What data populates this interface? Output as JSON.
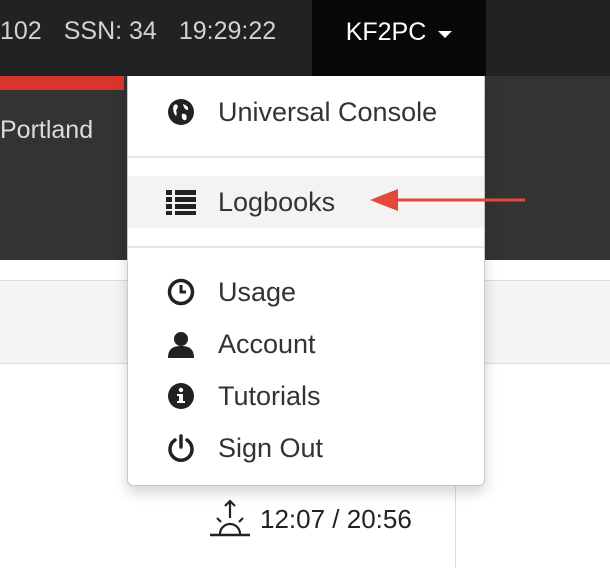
{
  "navbar": {
    "stats": [
      "102",
      "SSN: 34",
      "19:29:22"
    ],
    "user_label": "KF2PC"
  },
  "header": {
    "location": "Portland"
  },
  "dropdown": {
    "items": [
      {
        "label": "Universal Console",
        "icon": "globe-icon"
      },
      {
        "label": "Logbooks",
        "icon": "list-icon"
      },
      {
        "label": "Usage",
        "icon": "clock-icon"
      },
      {
        "label": "Account",
        "icon": "user-icon"
      },
      {
        "label": "Tutorials",
        "icon": "info-icon"
      },
      {
        "label": "Sign Out",
        "icon": "power-icon"
      }
    ]
  },
  "sun": {
    "times": "12:07 / 20:56",
    "icon": "sunrise-icon"
  },
  "colors": {
    "navbar_bg": "#222222",
    "toggle_bg": "#080808",
    "band_bg": "#333333",
    "accent_red": "#d9362b",
    "arrow": "#e5493a"
  }
}
